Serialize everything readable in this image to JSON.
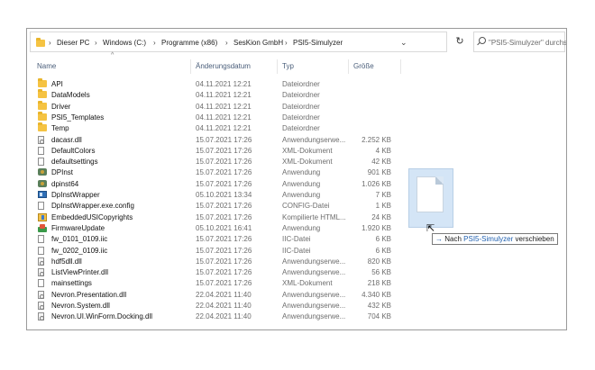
{
  "breadcrumb": {
    "items": [
      "Dieser PC",
      "Windows (C:)",
      "Programme (x86)",
      "SesKion GmbH",
      "PSI5-Simulyzer"
    ],
    "separator": "›"
  },
  "toolbar": {
    "dropdown_glyph": "⌄",
    "refresh_glyph": "↻",
    "search_placeholder": "\"PSI5-Simulyzer\" durchsuchen"
  },
  "columns": {
    "name": "Name",
    "date": "Änderungsdatum",
    "type": "Typ",
    "size": "Größe",
    "sort_glyph": "^"
  },
  "files": [
    {
      "name": "API",
      "date": "04.11.2021 12:21",
      "type": "Dateiordner",
      "size": "",
      "icon": "folder"
    },
    {
      "name": "DataModels",
      "date": "04.11.2021 12:21",
      "type": "Dateiordner",
      "size": "",
      "icon": "folder"
    },
    {
      "name": "Driver",
      "date": "04.11.2021 12:21",
      "type": "Dateiordner",
      "size": "",
      "icon": "folder"
    },
    {
      "name": "PSI5_Templates",
      "date": "04.11.2021 12:21",
      "type": "Dateiordner",
      "size": "",
      "icon": "folder"
    },
    {
      "name": "Temp",
      "date": "04.11.2021 12:21",
      "type": "Dateiordner",
      "size": "",
      "icon": "folder"
    },
    {
      "name": "dacasr.dll",
      "date": "15.07.2021 17:26",
      "type": "Anwendungserwe...",
      "size": "2.252 KB",
      "icon": "dll"
    },
    {
      "name": "DefaultColors",
      "date": "15.07.2021 17:26",
      "type": "XML-Dokument",
      "size": "4 KB",
      "icon": "file"
    },
    {
      "name": "defaultsettings",
      "date": "15.07.2021 17:26",
      "type": "XML-Dokument",
      "size": "42 KB",
      "icon": "file"
    },
    {
      "name": "DPInst",
      "date": "15.07.2021 17:26",
      "type": "Anwendung",
      "size": "901 KB",
      "icon": "gear"
    },
    {
      "name": "dpinst64",
      "date": "15.07.2021 17:26",
      "type": "Anwendung",
      "size": "1.026 KB",
      "icon": "gear"
    },
    {
      "name": "DpInstWrapper",
      "date": "05.10.2021 13:34",
      "type": "Anwendung",
      "size": "7 KB",
      "icon": "app"
    },
    {
      "name": "DpInstWrapper.exe.config",
      "date": "15.07.2021 17:26",
      "type": "CONFIG-Datei",
      "size": "1 KB",
      "icon": "file"
    },
    {
      "name": "EmbeddedUSICopyrights",
      "date": "15.07.2021 17:26",
      "type": "Kompilierte HTML...",
      "size": "24 KB",
      "icon": "html"
    },
    {
      "name": "FirmwareUpdate",
      "date": "05.10.2021 16:41",
      "type": "Anwendung",
      "size": "1.920 KB",
      "icon": "update"
    },
    {
      "name": "fw_0101_0109.iic",
      "date": "15.07.2021 17:26",
      "type": "IIC-Datei",
      "size": "6 KB",
      "icon": "file"
    },
    {
      "name": "fw_0202_0109.iic",
      "date": "15.07.2021 17:26",
      "type": "IIC-Datei",
      "size": "6 KB",
      "icon": "file"
    },
    {
      "name": "hdf5dll.dll",
      "date": "15.07.2021 17:26",
      "type": "Anwendungserwe...",
      "size": "820 KB",
      "icon": "dll"
    },
    {
      "name": "ListViewPrinter.dll",
      "date": "15.07.2021 17:26",
      "type": "Anwendungserwe...",
      "size": "56 KB",
      "icon": "dll"
    },
    {
      "name": "mainsettings",
      "date": "15.07.2021 17:26",
      "type": "XML-Dokument",
      "size": "218 KB",
      "icon": "file"
    },
    {
      "name": "Nevron.Presentation.dll",
      "date": "22.04.2021 11:40",
      "type": "Anwendungserwe...",
      "size": "4.340 KB",
      "icon": "dll"
    },
    {
      "name": "Nevron.System.dll",
      "date": "22.04.2021 11:40",
      "type": "Anwendungserwe...",
      "size": "432 KB",
      "icon": "dll"
    },
    {
      "name": "Nevron.UI.WinForm.Docking.dll",
      "date": "22.04.2021 11:40",
      "type": "Anwendungserwe...",
      "size": "704 KB",
      "icon": "dll"
    }
  ],
  "drag_tooltip": {
    "arrow": "→",
    "verb": "Nach",
    "target": "PSI5-Simulyzer",
    "action": "verschieben"
  },
  "colors": {
    "folder": "#f5c342",
    "link_blue": "#1f5fae",
    "header_text": "#4a5e7a",
    "drag_ghost": "#cde1f5"
  }
}
